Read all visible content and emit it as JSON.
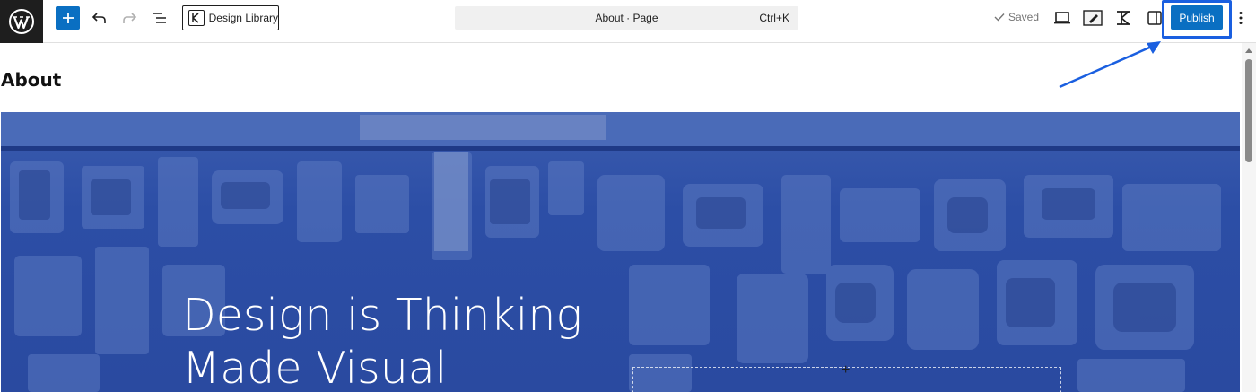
{
  "toolbar": {
    "logo": "wordpress-logo",
    "add_block_label": "+",
    "design_library_label": "Design Library",
    "command_center": {
      "title": "About · Page",
      "shortcut": "Ctrl+K"
    },
    "saved_label": "Saved",
    "publish_label": "Publish",
    "accent_color": "#0a6fc2",
    "highlight_color": "#1a5fe0"
  },
  "canvas": {
    "page_title": "About",
    "cover": {
      "heading_line1": "Design is Thinking",
      "heading_line2": "Made Visual",
      "overlay_color": "#2c4ea6"
    }
  },
  "icons": [
    "wordpress-icon",
    "plus-icon",
    "undo-icon",
    "redo-icon",
    "list-view-icon",
    "design-library-icon",
    "check-icon",
    "preview-desktop-icon",
    "styles-icon",
    "kadence-icon",
    "settings-sidebar-icon",
    "options-icon"
  ]
}
